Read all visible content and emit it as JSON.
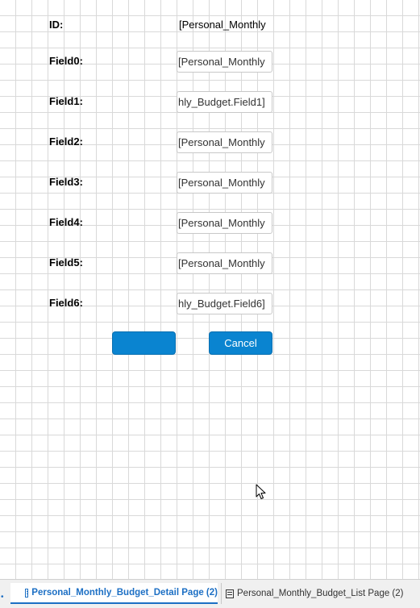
{
  "form": {
    "id_label": "ID:",
    "id_value": "[Personal_Monthly",
    "fields": [
      {
        "label": "Field0:",
        "value": "[Personal_Monthly"
      },
      {
        "label": "Field1:",
        "value": "hly_Budget.Field1]"
      },
      {
        "label": "Field2:",
        "value": "[Personal_Monthly"
      },
      {
        "label": "Field3:",
        "value": "[Personal_Monthly"
      },
      {
        "label": "Field4:",
        "value": "[Personal_Monthly"
      },
      {
        "label": "Field5:",
        "value": "[Personal_Monthly"
      },
      {
        "label": "Field6:",
        "value": "hly_Budget.Field6]"
      }
    ],
    "ok_label": "",
    "cancel_label": "Cancel"
  },
  "tabs": [
    {
      "label": "Personal_Monthly_Budget_Detail Page (2)",
      "active": true,
      "icon": "page-icon"
    },
    {
      "label": "Personal_Monthly_Budget_List Page (2)",
      "active": false,
      "icon": "page-icon"
    }
  ],
  "colors": {
    "accent": "#0a84d0",
    "active_tab_text": "#1c6fc4",
    "grid_line": "#d9d9d9"
  }
}
